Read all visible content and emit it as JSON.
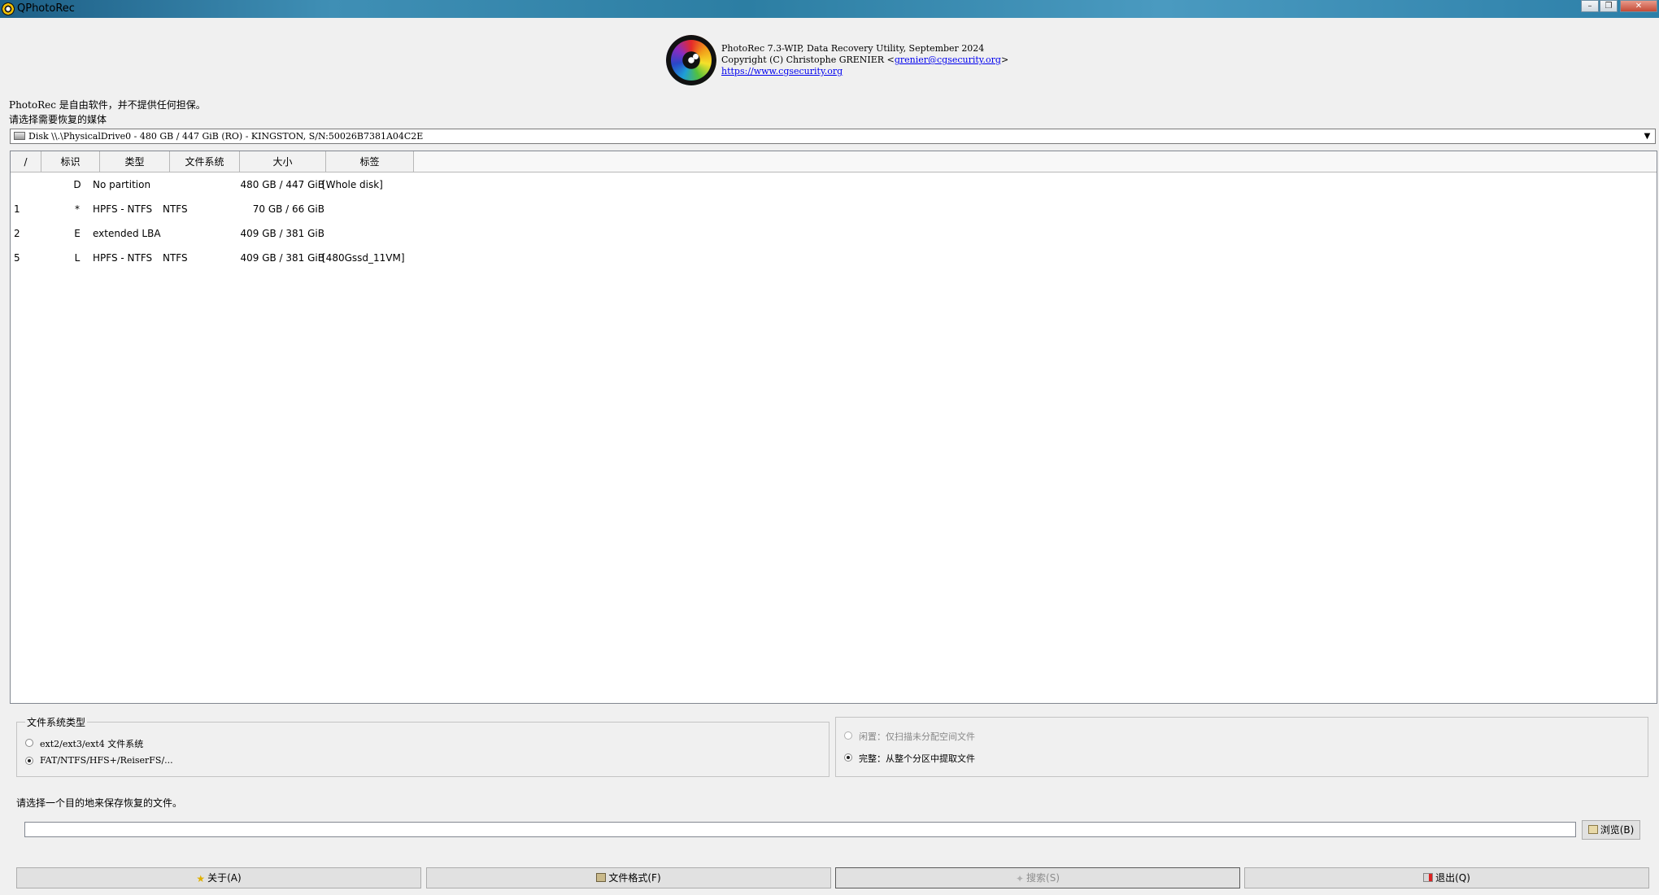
{
  "window": {
    "title": "QPhotoRec",
    "min_glyph": "–",
    "max_glyph": "❐",
    "close_glyph": "✕"
  },
  "header": {
    "line1": "PhotoRec 7.3-WIP, Data Recovery Utility, September 2024",
    "copyright_prefix": "Copyright (C) Christophe GRENIER <",
    "email": "grenier@cgsecurity.org",
    "copyright_suffix": ">",
    "url": "https://www.cgsecurity.org"
  },
  "intro": {
    "free_software": "PhotoRec 是自由软件，并不提供任何担保。",
    "select_media": "请选择需要恢复的媒体"
  },
  "disk_select": {
    "value": "Disk \\\\.\\PhysicalDrive0 - 480 GB / 447 GiB (RO) - KINGSTON, S/N:50026B7381A04C2E",
    "arrow": "▼"
  },
  "table": {
    "columns": [
      "/",
      "标识",
      "类型",
      "文件系统",
      "大小",
      "标签"
    ],
    "rows": [
      {
        "num": "",
        "flag": "D",
        "type": "No partition",
        "fs": "",
        "size": "480 GB / 447 GiB",
        "label": "[Whole disk]"
      },
      {
        "num": "1",
        "flag": "*",
        "type": "HPFS - NTFS",
        "fs": "NTFS",
        "size": "70 GB / 66 GiB",
        "label": ""
      },
      {
        "num": "2",
        "flag": "E",
        "type": "extended LBA",
        "fs": "",
        "size": "409 GB / 381 GiB",
        "label": ""
      },
      {
        "num": "5",
        "flag": "L",
        "type": "HPFS - NTFS",
        "fs": "NTFS",
        "size": "409 GB / 381 GiB",
        "label": "[480Gssd_11VM]"
      }
    ]
  },
  "fs_type": {
    "title": "文件系统类型",
    "options": [
      {
        "label": "ext2/ext3/ext4 文件系统",
        "selected": false
      },
      {
        "label": "FAT/NTFS/HFS+/ReiserFS/...",
        "selected": true
      }
    ]
  },
  "scan_mode": {
    "options": [
      {
        "label": "闲置：仅扫描未分配空间文件",
        "selected": false,
        "disabled": true
      },
      {
        "label": "完整：从整个分区中提取文件",
        "selected": true,
        "disabled": false
      }
    ]
  },
  "destination": {
    "prompt": "请选择一个目的地来保存恢复的文件。",
    "value": "",
    "browse_label": "浏览(B)"
  },
  "buttons": {
    "about": "关于(A)",
    "file_formats": "文件格式(F)",
    "search": "搜索(S)",
    "quit": "退出(Q)"
  },
  "colors": {
    "titlebar": "#2c7ea3",
    "link": "#0000ee",
    "window_bg": "#f0f0f0"
  }
}
